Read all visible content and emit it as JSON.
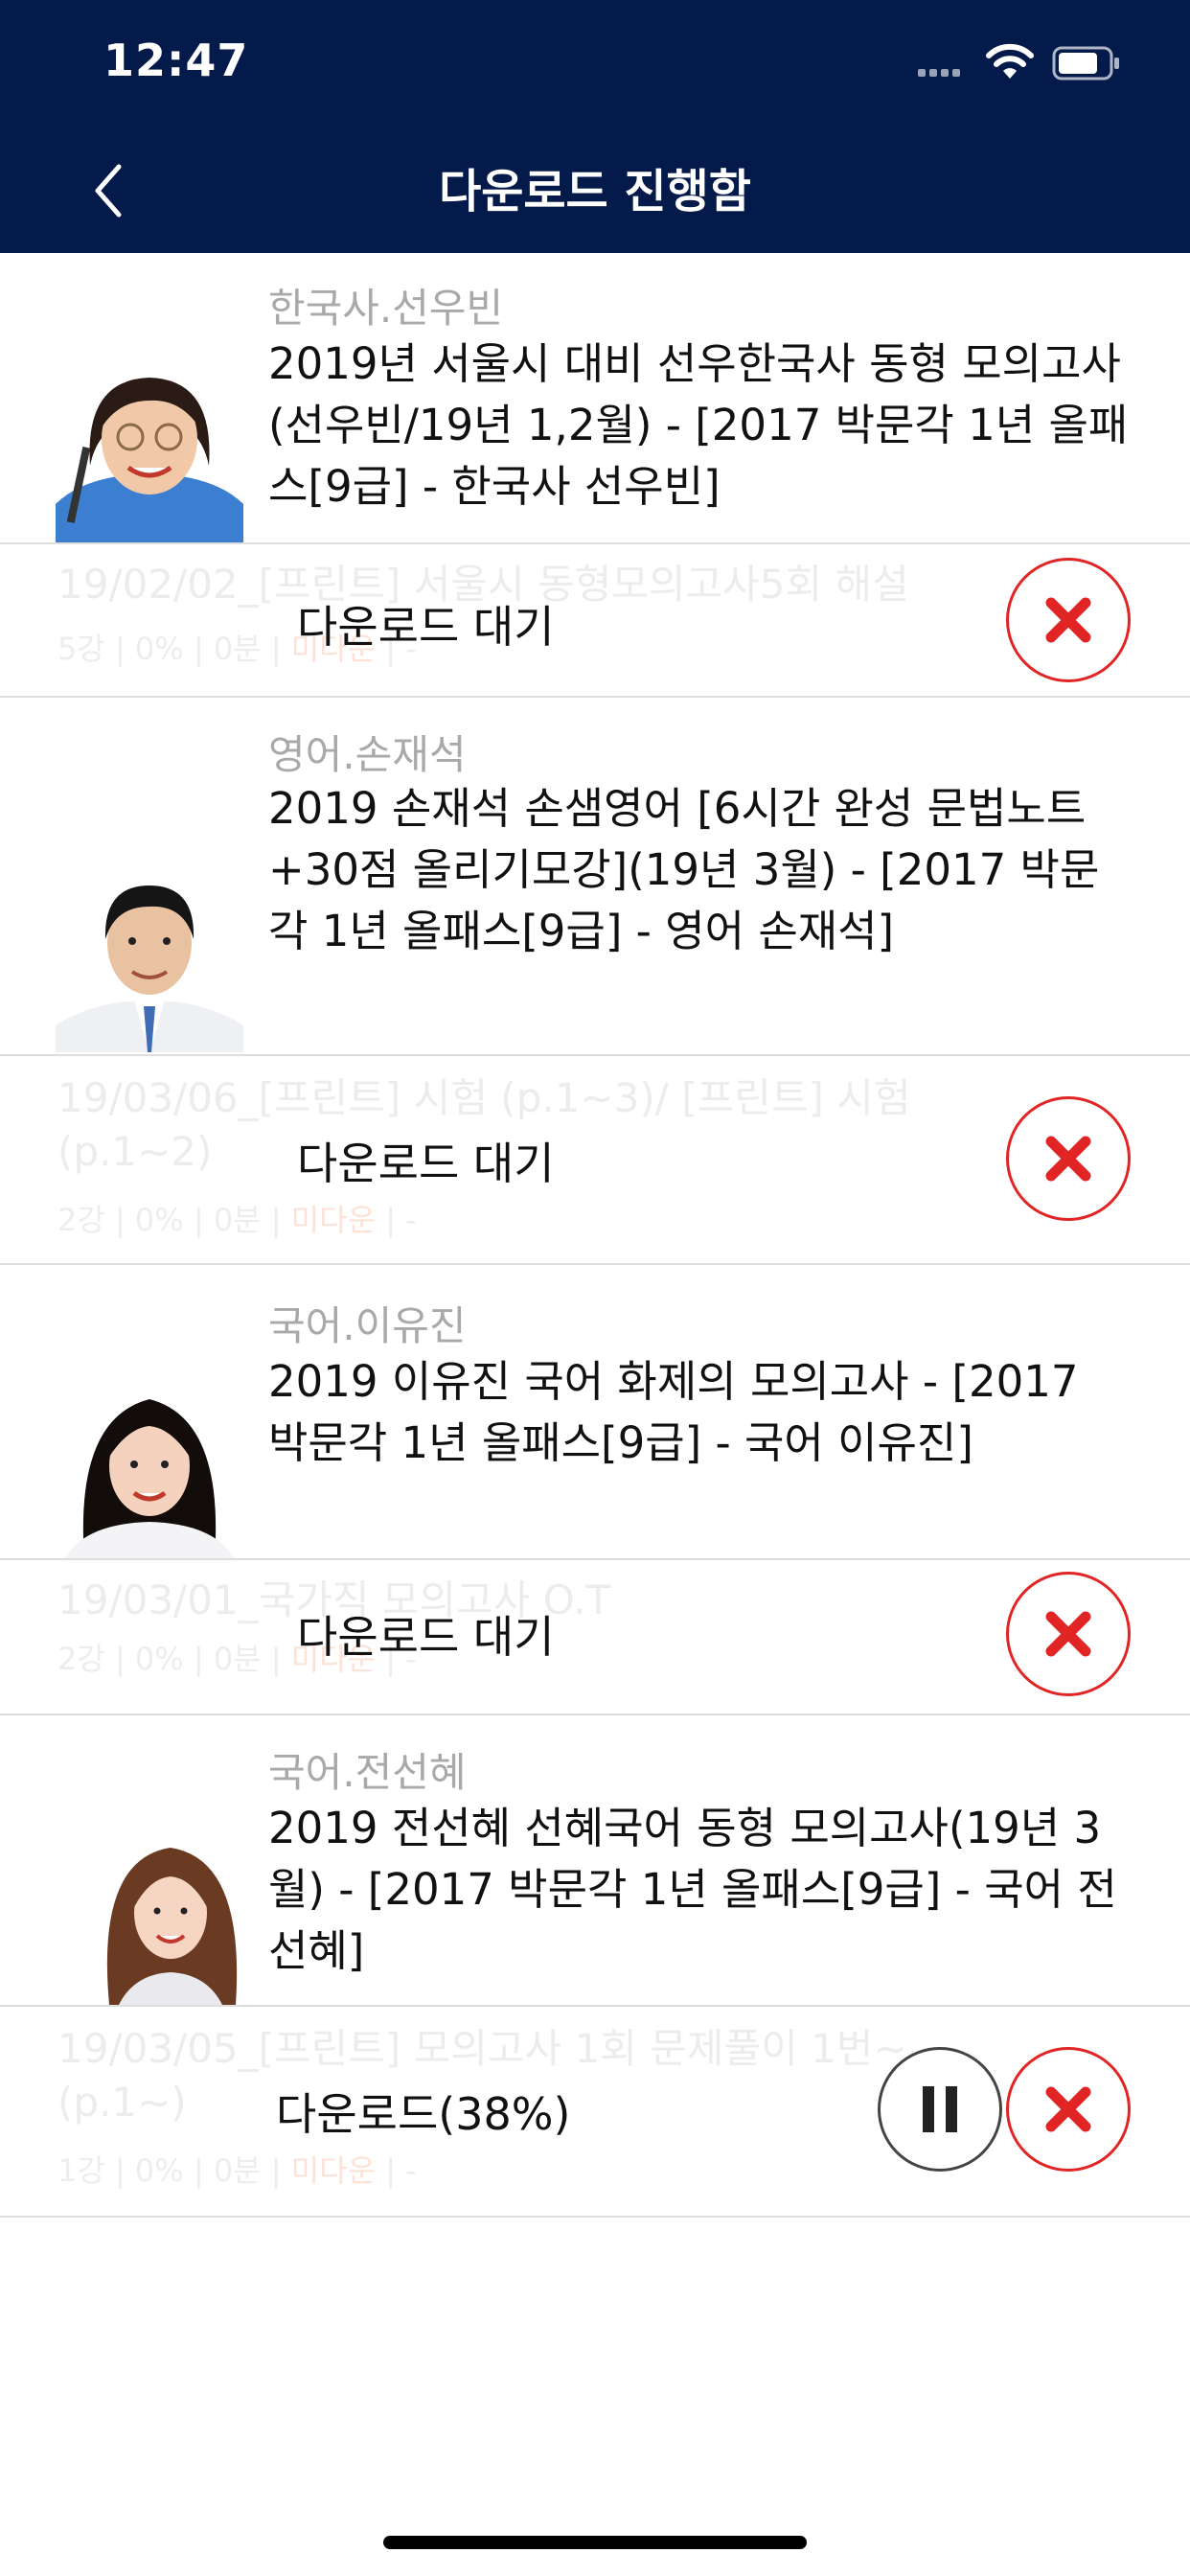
{
  "status_bar": {
    "time": "12:47"
  },
  "header": {
    "title": "다운로드 진행함",
    "back_icon": "chevron-left-icon"
  },
  "groups": [
    {
      "teacher": "한국사.선우빈",
      "course": " 2019년 서울시 대비 선우한국사 동형 모의고사(선우빈/19년 1,2월) - [2017 박문각 1년 올패스[9급] - 한국사 선우빈]",
      "item": {
        "title": "19/02/02_[프린트] 서울시 동형모의고사5회 해설",
        "meta_a": "5강 | 0% | 0분 | ",
        "meta_b": "미다운",
        "meta_c": " | -",
        "status": "다운로드 대기"
      }
    },
    {
      "teacher": "영어.손재석",
      "course": " 2019 손재석 손샘영어 [6시간 완성 문법노트+30점 올리기모강](19년 3월) - [2017 박문각 1년 올패스[9급] - 영어 손재석]",
      "item": {
        "title": "19/03/06_[프린트] 시험 (p.1~3)/ [프린트] 시험 (p.1~2)",
        "meta_a": "2강 | 0% | 0분 | ",
        "meta_b": "미다운",
        "meta_c": " | -",
        "status": "다운로드 대기"
      }
    },
    {
      "teacher": "국어.이유진",
      "course": " 2019 이유진 국어 화제의 모의고사 - [2017 박문각 1년 올패스[9급] - 국어 이유진]",
      "item": {
        "title": "19/03/01_국가직 모의고사 O.T",
        "meta_a": "2강 | 0% | 0분 | ",
        "meta_b": "미다운",
        "meta_c": " | -",
        "status": "다운로드 대기"
      }
    },
    {
      "teacher": "국어.전선혜",
      "course": " 2019 전선혜 선혜국어 동형 모의고사(19년 3월) - [2017 박문각 1년 올패스[9급] - 국어 전선혜]",
      "item": {
        "title": "19/03/05_[프린트] 모의고사 1회 문제풀이 1번~ (p.1~)",
        "meta_a": "1강 | 0% | 0분 | ",
        "meta_b": "미다운",
        "meta_c": " | -",
        "status": "다운로드(38%)"
      }
    }
  ],
  "colors": {
    "header_bg": "#041a4a",
    "cancel_red": "#e12424"
  }
}
